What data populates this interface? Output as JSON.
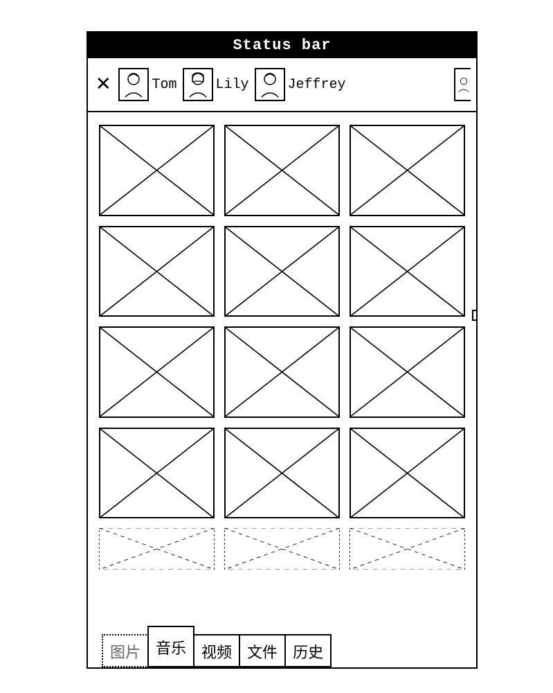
{
  "status_bar": {
    "title": "Status bar"
  },
  "contacts": {
    "close_label": "✕",
    "items": [
      {
        "name": "Tom"
      },
      {
        "name": "Lily"
      },
      {
        "name": "Jeffrey"
      }
    ],
    "overflow_contact": true
  },
  "gallery": {
    "full_rows": 4,
    "columns": 3,
    "partial_row_visible": true
  },
  "tabs": {
    "items": [
      {
        "label": "图片",
        "style": "dotted",
        "active": false
      },
      {
        "label": "音乐",
        "style": "solid",
        "active": true
      },
      {
        "label": "视频",
        "style": "solid",
        "active": false
      },
      {
        "label": "文件",
        "style": "solid",
        "active": false
      },
      {
        "label": "历史",
        "style": "solid",
        "active": false
      }
    ]
  }
}
